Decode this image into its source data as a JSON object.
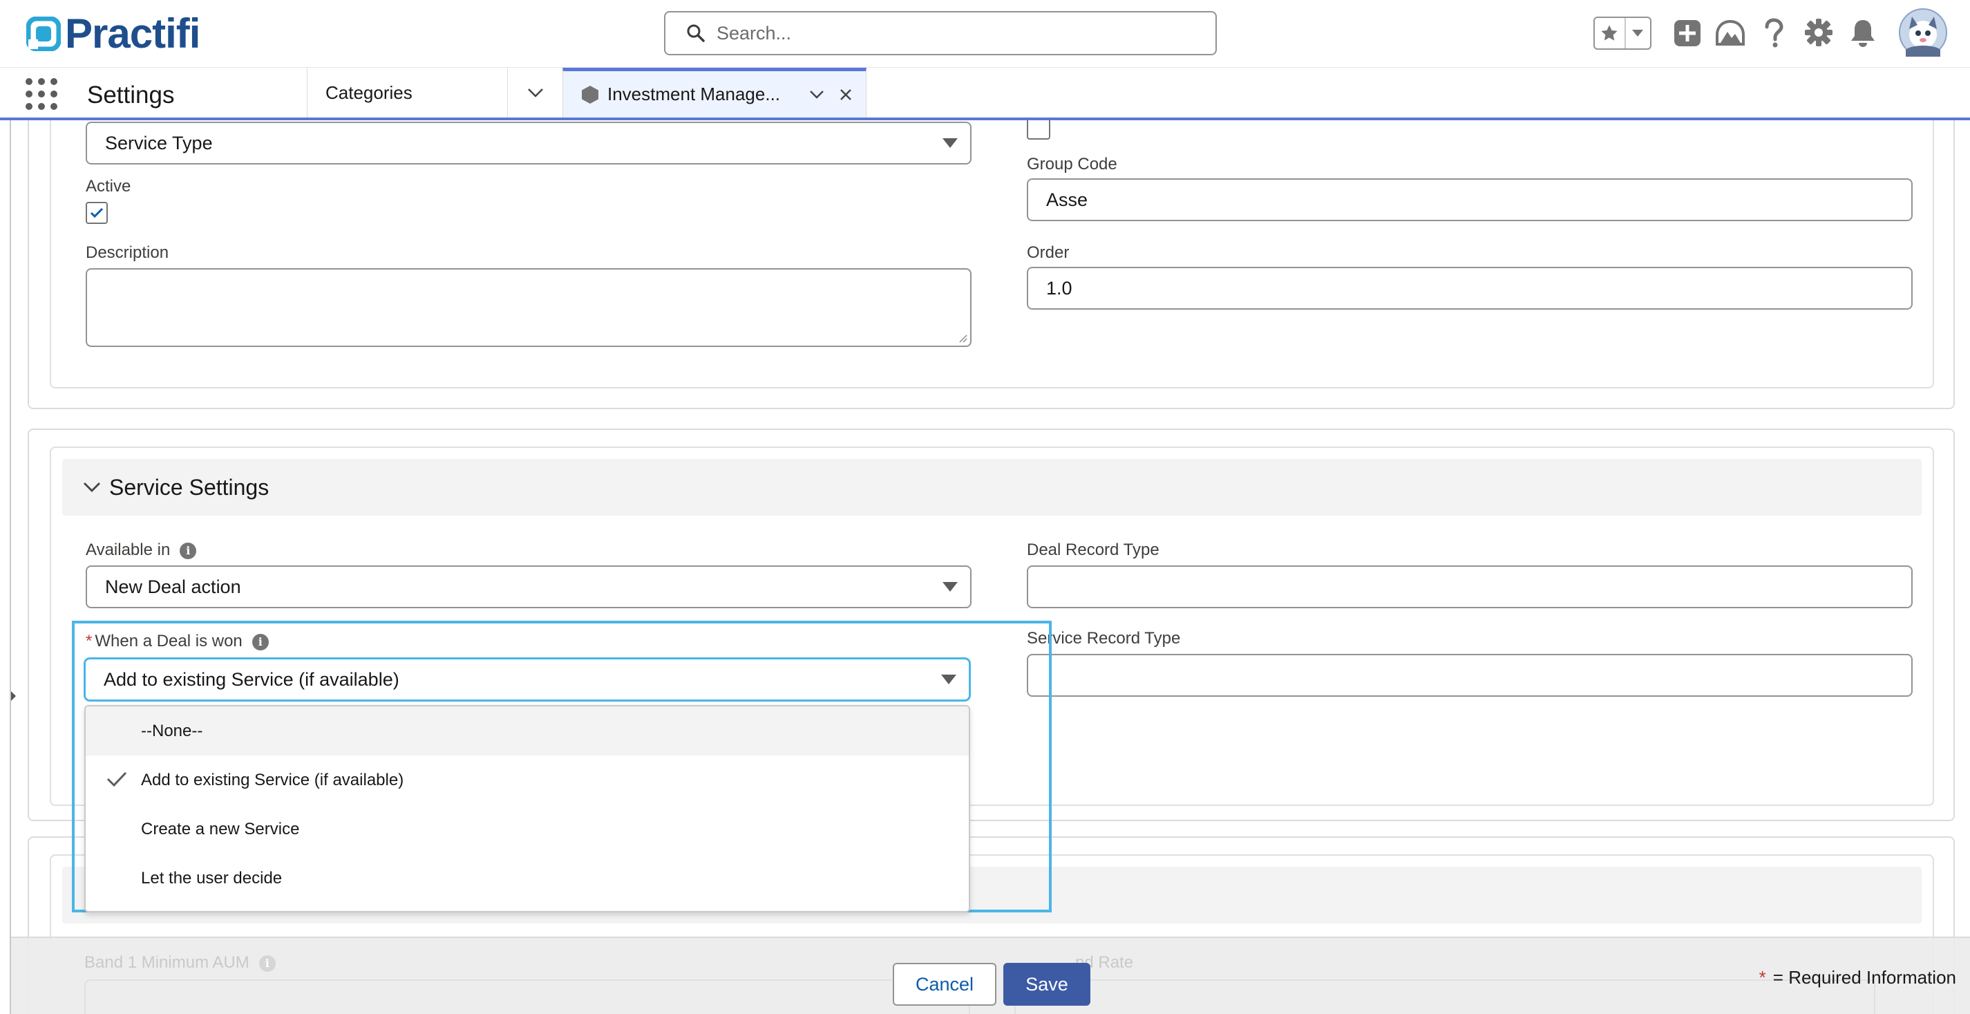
{
  "header": {
    "logo_text": "Practifi",
    "search_placeholder": "Search...",
    "icons": [
      "favorites-star-icon",
      "favorites-dropdown-icon",
      "global-actions-add-icon",
      "trailhead-icon",
      "help-icon",
      "setup-gear-icon",
      "notifications-bell-icon",
      "user-avatar"
    ]
  },
  "navbar": {
    "app_name": "Settings",
    "tabs": [
      {
        "label": "Categories"
      },
      {
        "label": "Investment Manage..."
      }
    ]
  },
  "form_top": {
    "service_type_value": "Service Type",
    "active_label": "Active",
    "active_checked": true,
    "description_label": "Description",
    "description_value": "",
    "group_code_label": "Group Code",
    "group_code_value": "Asse",
    "order_label": "Order",
    "order_value": "1.0"
  },
  "service_settings": {
    "title": "Service Settings",
    "available_in_label": "Available in",
    "available_in_value": "New Deal action",
    "deal_won_label": "When a Deal is won",
    "deal_won_required": "*",
    "deal_won_value": "Add to existing Service (if available)",
    "deal_record_type_label": "Deal Record Type",
    "deal_record_type_value": "",
    "service_record_type_label": "Service Record Type",
    "service_record_type_value": "",
    "dropdown_options": [
      {
        "label": "--None--",
        "selected": false
      },
      {
        "label": "Add to existing Service (if available)",
        "selected": true
      },
      {
        "label": "Create a new Service",
        "selected": false
      },
      {
        "label": "Let the user decide",
        "selected": false
      }
    ]
  },
  "faded": {
    "band_label": "Band 1 Minimum AUM",
    "right_label_partial": "nd Rate"
  },
  "footer": {
    "cancel_label": "Cancel",
    "save_label": "Save",
    "required_star": "*",
    "required_info": "= Required Information"
  },
  "colors": {
    "brand": "#1f4e8c",
    "accent": "#5a78d8",
    "focus": "#4bb5e8",
    "save_button": "#3d5aa5",
    "required": "#c23934"
  }
}
